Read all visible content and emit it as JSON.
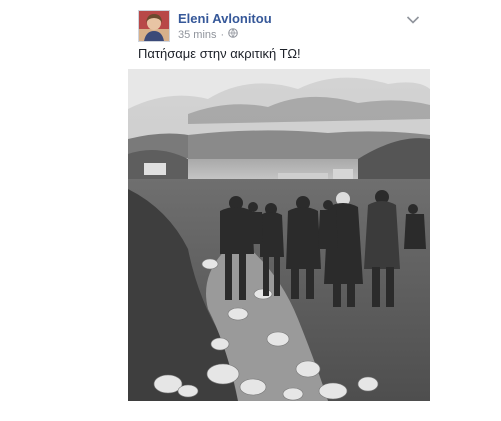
{
  "post": {
    "author": "Eleni Avlonitou",
    "time": "35 mins",
    "separator": "·",
    "privacy_icon": "globe-icon",
    "options_icon": "chevron-down-icon",
    "text": "Πατήσαμε στην ακριτική ΤΩ!"
  },
  "photo": {
    "style": "black-and-white",
    "content": "group of people walking down a rocky path towards the sea"
  }
}
